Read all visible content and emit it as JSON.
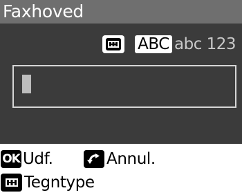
{
  "screen": {
    "title": "Faxhoved"
  },
  "input_mode": {
    "icon": "text-mode-icon",
    "selected": "ABC",
    "others": "abc 123"
  },
  "input_field": {
    "value": ""
  },
  "soft_keys": {
    "ok": {
      "key": "OK",
      "label": "Udf."
    },
    "back": {
      "icon": "back-arrow-icon",
      "label": "Annul."
    },
    "mode": {
      "icon": "text-mode-icon",
      "label": "Tegntype"
    }
  },
  "colors": {
    "title_bar": "#6f6f6f",
    "content_bg": "#3b3b3b",
    "mode_inactive_text": "#c9c9c9",
    "cursor": "#bdbdbd"
  }
}
